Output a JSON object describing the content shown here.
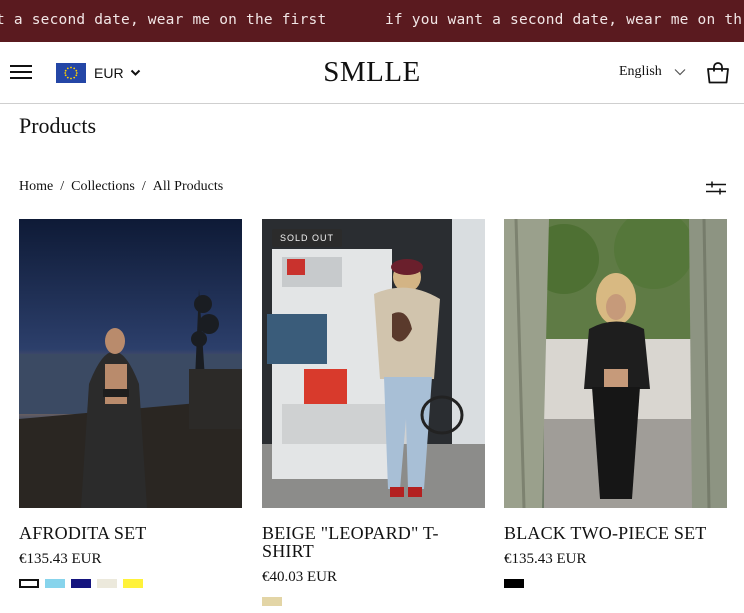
{
  "announcement": {
    "text_left": "t a second date, wear me on the first",
    "text_right": "if you want a second date, wear me on th"
  },
  "header": {
    "menu_icon": "hamburger-menu-icon",
    "currency": {
      "flag_icon": "eu-flag-icon",
      "label": "EUR"
    },
    "logo": "SMLLE",
    "language": "English",
    "cart_icon": "shopping-bag-icon"
  },
  "page": {
    "title": "Products"
  },
  "breadcrumb": {
    "items": [
      "Home",
      "Collections",
      "All Products"
    ],
    "separator": "/"
  },
  "filter_icon": "sliders-icon",
  "products": [
    {
      "title": "AFRODITA SET",
      "price": "€135.43 EUR",
      "badge": "",
      "swatches": [
        "#ffffff",
        "#87d4ec",
        "#14147e",
        "#ece9dc",
        "#fff23a"
      ]
    },
    {
      "title": "BEIGE \"LEOPARD\" T-SHIRT",
      "price": "€40.03 EUR",
      "badge": "SOLD OUT",
      "swatches": [
        "#e3d5a6"
      ]
    },
    {
      "title": "BLACK TWO-PIECE SET",
      "price": "€135.43 EUR",
      "badge": "",
      "swatches": [
        "#000000"
      ]
    }
  ],
  "colors": {
    "announcement_bg": "#5a1a1f",
    "text": "#111111",
    "header_border": "#cfcfcf"
  }
}
